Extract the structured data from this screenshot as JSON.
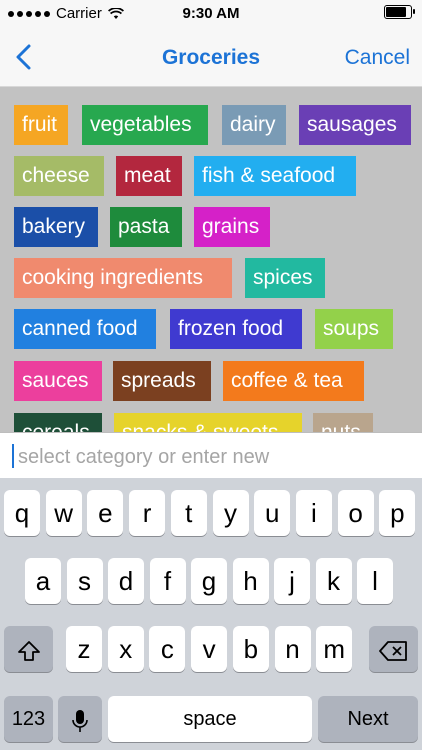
{
  "status": {
    "carrier": "Carrier",
    "time": "9:30 AM",
    "signal_dots": 5,
    "battery_level": 0.9
  },
  "nav": {
    "back_icon": "chevron-left-icon",
    "title": "Groceries",
    "cancel": "Cancel",
    "accent": "#1c73d6"
  },
  "tags": [
    {
      "label": "fruit",
      "color": "#f5a623"
    },
    {
      "label": "vegetables",
      "color": "#27a84f"
    },
    {
      "label": "dairy",
      "color": "#7a9bb5"
    },
    {
      "label": "sausages",
      "color": "#6a3fb5"
    },
    {
      "label": "cheese",
      "color": "#a5bb67"
    },
    {
      "label": "meat",
      "color": "#b3273e"
    },
    {
      "label": "fish & seafood",
      "color": "#22aef0"
    },
    {
      "label": "bakery",
      "color": "#1b4fa8"
    },
    {
      "label": "pasta",
      "color": "#1e8b3c"
    },
    {
      "label": "grains",
      "color": "#d521c8"
    },
    {
      "label": "cooking ingredients",
      "color": "#f08a6e"
    },
    {
      "label": "spices",
      "color": "#22b9a0"
    },
    {
      "label": "canned food",
      "color": "#2180e0"
    },
    {
      "label": "frozen food",
      "color": "#3f3ad0"
    },
    {
      "label": "soups",
      "color": "#93d14a"
    },
    {
      "label": "sauces",
      "color": "#ec3f9d"
    },
    {
      "label": "spreads",
      "color": "#7b4020"
    },
    {
      "label": "coffee & tea",
      "color": "#f37a1c"
    },
    {
      "label": "cereals",
      "color": "#1e4f38"
    },
    {
      "label": "snacks & sweets",
      "color": "#e6d32b"
    },
    {
      "label": "nuts",
      "color": "#b9a58d"
    }
  ],
  "input": {
    "placeholder": "select category or enter new",
    "value": ""
  },
  "keyboard": {
    "row1": [
      "q",
      "w",
      "e",
      "r",
      "t",
      "y",
      "u",
      "i",
      "o",
      "p"
    ],
    "row2": [
      "a",
      "s",
      "d",
      "f",
      "g",
      "h",
      "j",
      "k",
      "l"
    ],
    "row3": [
      "z",
      "x",
      "c",
      "v",
      "b",
      "n",
      "m"
    ],
    "numbers_key": "123",
    "space_key": "space",
    "next_key": "Next",
    "shift_icon": "shift-icon",
    "backspace_icon": "backspace-icon",
    "mic_icon": "microphone-icon"
  }
}
